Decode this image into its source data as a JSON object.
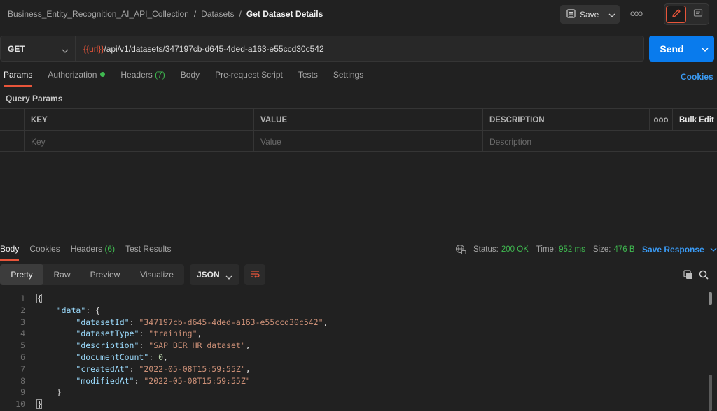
{
  "breadcrumb": {
    "collection": "Business_Entity_Recognition_AI_API_Collection",
    "folder": "Datasets",
    "separator": "/",
    "current": "Get Dataset Details"
  },
  "toolbar": {
    "save_label": "Save",
    "more_label": "ooo"
  },
  "request": {
    "method": "GET",
    "url_variable": "{{url}}",
    "url_path": "/api/v1/datasets/347197cb-d645-4ded-a163-e55ccd30c542",
    "send_label": "Send"
  },
  "request_tabs": [
    {
      "label": "Params",
      "active": true
    },
    {
      "label": "Authorization",
      "status_dot": true
    },
    {
      "label": "Headers",
      "count": "(7)"
    },
    {
      "label": "Body"
    },
    {
      "label": "Pre-request Script"
    },
    {
      "label": "Tests"
    },
    {
      "label": "Settings"
    }
  ],
  "cookies_label": "Cookies",
  "query_params": {
    "title": "Query Params",
    "columns": [
      "KEY",
      "VALUE",
      "DESCRIPTION"
    ],
    "more_label": "ooo",
    "bulk_edit_label": "Bulk Edit",
    "placeholders": [
      "Key",
      "Value",
      "Description"
    ]
  },
  "response_tabs": [
    {
      "label": "Body",
      "active": true
    },
    {
      "label": "Cookies"
    },
    {
      "label": "Headers",
      "count": "(6)"
    },
    {
      "label": "Test Results"
    }
  ],
  "response_status": {
    "status_label": "Status:",
    "status_value": "200 OK",
    "time_label": "Time:",
    "time_value": "952 ms",
    "size_label": "Size:",
    "size_value": "476 B",
    "save_response_label": "Save Response"
  },
  "view_modes": [
    "Pretty",
    "Raw",
    "Preview",
    "Visualize"
  ],
  "active_view": "Pretty",
  "format": "JSON",
  "code_lines": [
    {
      "n": "1",
      "text": "{"
    },
    {
      "n": "2",
      "indent": 1,
      "key": "\"data\"",
      "tail": ": {"
    },
    {
      "n": "3",
      "indent": 2,
      "key": "\"datasetId\"",
      "str": "\"347197cb-d645-4ded-a163-e55ccd30c542\"",
      "comma": true
    },
    {
      "n": "4",
      "indent": 2,
      "key": "\"datasetType\"",
      "str": "\"training\"",
      "comma": true
    },
    {
      "n": "5",
      "indent": 2,
      "key": "\"description\"",
      "str": "\"SAP BER HR dataset\"",
      "comma": true
    },
    {
      "n": "6",
      "indent": 2,
      "key": "\"documentCount\"",
      "num": "0",
      "comma": true
    },
    {
      "n": "7",
      "indent": 2,
      "key": "\"createdAt\"",
      "str": "\"2022-05-08T15:59:55Z\"",
      "comma": true
    },
    {
      "n": "8",
      "indent": 2,
      "key": "\"modifiedAt\"",
      "str": "\"2022-05-08T15:59:55Z\""
    },
    {
      "n": "9",
      "indent": 1,
      "text": "}"
    },
    {
      "n": "10",
      "text": "}"
    }
  ],
  "colors": {
    "accent": "#e8553a",
    "primary": "#097bed",
    "success": "#3fb950",
    "link": "#3a9bf5"
  }
}
